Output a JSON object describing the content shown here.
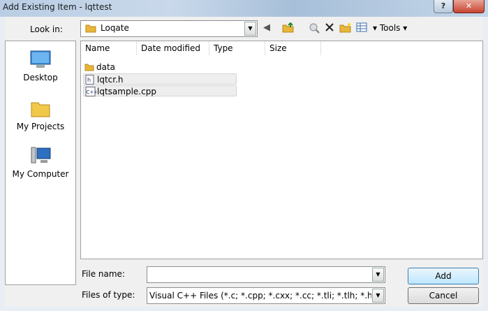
{
  "window": {
    "title": "Add Existing Item - lqttest",
    "help_label": "?",
    "close_label": "✕"
  },
  "lookin": {
    "label": "Look in:",
    "value": "Loqate"
  },
  "toolbar": {
    "tools_label": "Tools",
    "icons": [
      "back-icon",
      "up-folder-icon",
      "search-web-icon",
      "delete-icon",
      "new-folder-icon",
      "views-icon"
    ]
  },
  "places": [
    {
      "label": "Desktop",
      "icon": "desktop-icon"
    },
    {
      "label": "My Projects",
      "icon": "folder-icon"
    },
    {
      "label": "My Computer",
      "icon": "computer-icon"
    }
  ],
  "columns": [
    "Name",
    "Date modified",
    "Type",
    "Size"
  ],
  "files": [
    {
      "name": "data",
      "icon": "folder-icon"
    },
    {
      "name": "lqtcr.h",
      "icon": "h-file-icon"
    },
    {
      "name": "lqtsample.cpp",
      "icon": "cpp-file-icon"
    }
  ],
  "file_name": {
    "label": "File name:",
    "value": ""
  },
  "file_type": {
    "label": "Files of type:",
    "value": "Visual C++ Files (*.c; *.cpp; *.cxx; *.cc; *.tli; *.tlh; *.h; *.hpp; *.hxx; *.hh; *.inl; *.rc; *.resx; *.idl; *.rc2; *.def; *.odl; *.asm; *.asmx; *.xsd; *.bin; *.rgs; *.html; *.htm; *.manifest)"
  },
  "buttons": {
    "add": "Add",
    "cancel": "Cancel"
  }
}
